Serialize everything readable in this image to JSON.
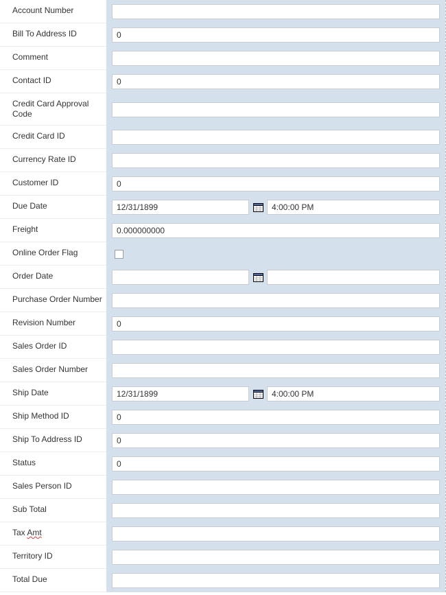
{
  "fields": {
    "account_number": {
      "label": "Account Number",
      "value": ""
    },
    "bill_to_address_id": {
      "label": "Bill To Address ID",
      "value": "0"
    },
    "comment": {
      "label": "Comment",
      "value": ""
    },
    "contact_id": {
      "label": "Contact ID",
      "value": "0"
    },
    "credit_card_approval_code": {
      "label": "Credit Card Approval Code",
      "value": ""
    },
    "credit_card_id": {
      "label": "Credit Card ID",
      "value": ""
    },
    "currency_rate_id": {
      "label": "Currency Rate ID",
      "value": ""
    },
    "customer_id": {
      "label": "Customer ID",
      "value": "0"
    },
    "due_date": {
      "label": "Due Date",
      "date": "12/31/1899",
      "time": "4:00:00 PM"
    },
    "freight": {
      "label": "Freight",
      "value": "0.000000000"
    },
    "online_order_flag": {
      "label": "Online Order Flag",
      "checked": false
    },
    "order_date": {
      "label": "Order Date",
      "date": "",
      "time": ""
    },
    "purchase_order_number": {
      "label": "Purchase Order Number",
      "value": ""
    },
    "revision_number": {
      "label": "Revision Number",
      "value": "0"
    },
    "sales_order_id": {
      "label": "Sales Order ID",
      "value": ""
    },
    "sales_order_number": {
      "label": "Sales Order Number",
      "value": ""
    },
    "ship_date": {
      "label": "Ship Date",
      "date": "12/31/1899",
      "time": "4:00:00 PM"
    },
    "ship_method_id": {
      "label": "Ship Method ID",
      "value": "0"
    },
    "ship_to_address_id": {
      "label": "Ship To Address ID",
      "value": "0"
    },
    "status": {
      "label": "Status",
      "value": "0"
    },
    "sales_person_id": {
      "label": "Sales Person ID",
      "value": ""
    },
    "sub_total": {
      "label": "Sub Total",
      "value": ""
    },
    "tax_amt": {
      "label_pre": "Tax ",
      "label_underlined": "Amt",
      "value": ""
    },
    "territory_id": {
      "label": "Territory ID",
      "value": ""
    },
    "total_due": {
      "label": "Total Due",
      "value": ""
    }
  }
}
